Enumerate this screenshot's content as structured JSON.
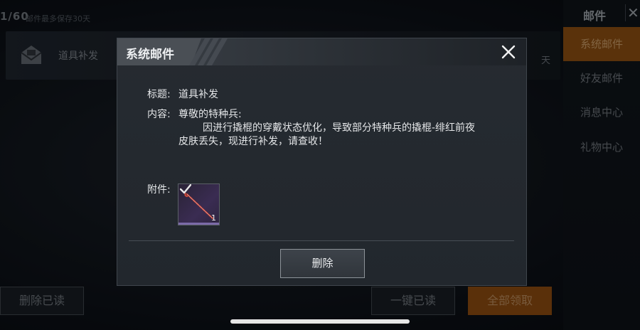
{
  "background": {
    "counter": "1/60",
    "retention_note": "邮件最多保存30天",
    "mail_item": {
      "title": "道具补发",
      "days": "天"
    },
    "sidebar": {
      "title": "邮件",
      "tabs": [
        {
          "label": "系统邮件",
          "active": true
        },
        {
          "label": "好友邮件",
          "active": false
        },
        {
          "label": "消息中心",
          "active": false
        },
        {
          "label": "礼物中心",
          "active": false
        }
      ]
    },
    "buttons": {
      "delete_read": "删除已读",
      "one_click_read": "一键已读",
      "claim_all": "全部领取"
    }
  },
  "modal": {
    "title": "系统邮件",
    "subject_label": "标题:",
    "subject_value": "道具补发",
    "content_label": "内容:",
    "content_greeting": "尊敬的特种兵:",
    "content_line1": "因进行撬棍的穿戴状态优化，导致部分特种兵的撬棍-绯红前夜",
    "content_line2": "皮肤丢失，现进行补发，请查收！",
    "attachment_label": "附件:",
    "attachment": {
      "icon": "crowbar-skin-icon",
      "count": "1",
      "claimed": true
    },
    "delete_label": "删除"
  },
  "colors": {
    "accent_orange": "#8a4e12",
    "modal_bg": "#22272d",
    "attachment_purple": "#7b6aa8"
  }
}
